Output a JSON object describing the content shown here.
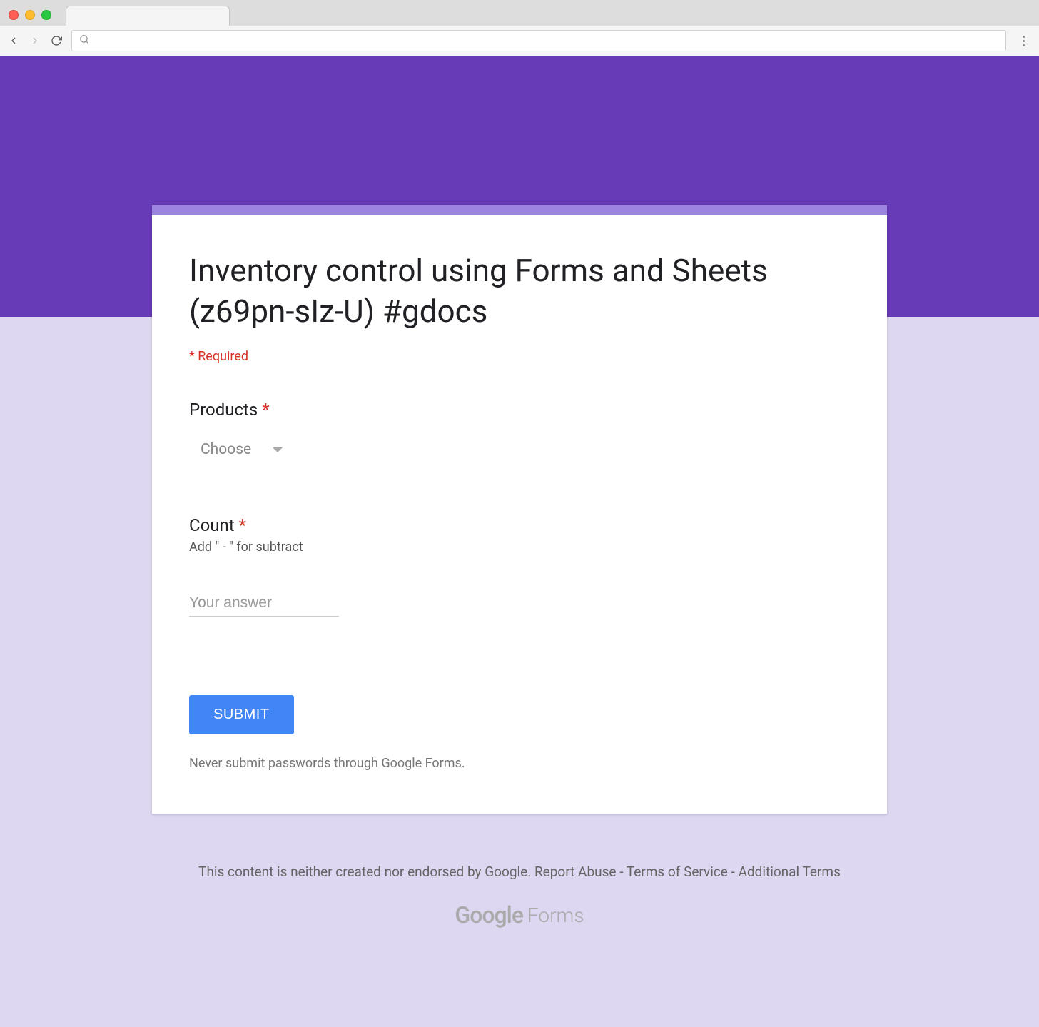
{
  "browser": {
    "address_value": ""
  },
  "form": {
    "title": "Inventory control using Forms and Sheets (z69pn-sIz-U) #gdocs",
    "required_label": "* Required",
    "questions": {
      "products": {
        "label": "Products",
        "asterisk": "*",
        "dropdown_placeholder": "Choose"
      },
      "count": {
        "label": "Count",
        "asterisk": "*",
        "description": "Add \" - \" for subtract",
        "placeholder": "Your answer"
      }
    },
    "submit_label": "SUBMIT",
    "password_warning": "Never submit passwords through Google Forms."
  },
  "footer": {
    "disclaimer": "This content is neither created nor endorsed by Google.",
    "report_abuse": "Report Abuse",
    "terms": "Terms of Service",
    "additional_terms": "Additional Terms",
    "sep": " - ",
    "logo_google": "Google",
    "logo_forms": "Forms"
  }
}
